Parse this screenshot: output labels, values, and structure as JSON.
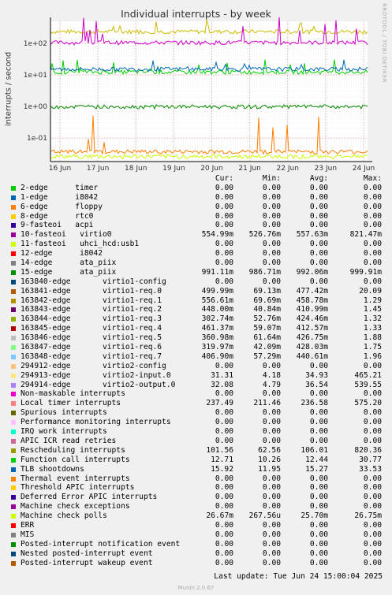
{
  "chart_data": {
    "type": "line",
    "title": "Individual interrupts - by week",
    "ylabel": "interrupts / second",
    "yscale": "log",
    "ylim": [
      0.018,
      500
    ],
    "yticks": [
      "1e+02",
      "1e+01",
      "1e+00",
      "1e-01"
    ],
    "yticks_values": [
      100,
      10,
      1,
      0.1
    ],
    "xticks": [
      "16 Jun",
      "17 Jun",
      "18 Jun",
      "19 Jun",
      "20 Jun",
      "21 Jun",
      "22 Jun",
      "23 Jun",
      "24 Jun"
    ],
    "grid": true,
    "watermark": "RRDTOOL / TOBI OETIKER",
    "series_approx": [
      {
        "name": "Local timer interrupts",
        "color": "#CCBB00",
        "typical": 236,
        "peak": 575
      },
      {
        "name": "Rescheduling interrupts",
        "color": "#CC00CC",
        "typical": 106,
        "peak": 820
      },
      {
        "name": "Function call interrupts",
        "color": "#00CC00",
        "typical": 12.4,
        "peak": 30.8
      },
      {
        "name": "TLB shootdowns",
        "color": "#0066B3",
        "typical": 15.3,
        "peak": 33.5
      },
      {
        "name": "15-edge",
        "color": "#008F00",
        "typical": 0.99,
        "peak": 1.0
      },
      {
        "name": "294914-edge",
        "color": "#FF7F00",
        "typical": 0.037,
        "peak": 0.54
      },
      {
        "name": "Machine check polls",
        "color": "#CCFF00",
        "typical": 0.026,
        "peak": 0.027
      }
    ],
    "colors": {
      "background": "#F0F0F0",
      "plot": "#FFFFFF",
      "grid": "#E0E0E0"
    }
  },
  "legend": {
    "headers": [
      "Cur:",
      "Min:",
      "Avg:",
      "Max:"
    ],
    "rows": [
      {
        "color": "#00CC00",
        "label": "2-edge      timer",
        "cur": "0.00",
        "min": "0.00",
        "avg": "0.00",
        "max": "0.00"
      },
      {
        "color": "#0066B3",
        "label": "1-edge      i8042",
        "cur": "0.00",
        "min": "0.00",
        "avg": "0.00",
        "max": "0.00"
      },
      {
        "color": "#FF8000",
        "label": "6-edge      floppy",
        "cur": "0.00",
        "min": "0.00",
        "avg": "0.00",
        "max": "0.00"
      },
      {
        "color": "#FFCC00",
        "label": "8-edge      rtc0",
        "cur": "0.00",
        "min": "0.00",
        "avg": "0.00",
        "max": "0.00"
      },
      {
        "color": "#330099",
        "label": "9-fasteoi   acpi",
        "cur": "0.00",
        "min": "0.00",
        "avg": "0.00",
        "max": "0.00"
      },
      {
        "color": "#990099",
        "label": "10-fasteoi   virtio0",
        "cur": "554.99m",
        "min": "526.76m",
        "avg": "557.63m",
        "max": "821.47m"
      },
      {
        "color": "#CCFF00",
        "label": "11-fasteoi   uhci_hcd:usb1",
        "cur": "0.00",
        "min": "0.00",
        "avg": "0.00",
        "max": "0.00"
      },
      {
        "color": "#FF0000",
        "label": "12-edge      i8042",
        "cur": "0.00",
        "min": "0.00",
        "avg": "0.00",
        "max": "0.00"
      },
      {
        "color": "#808080",
        "label": "14-edge      ata_piix",
        "cur": "0.00",
        "min": "0.00",
        "avg": "0.00",
        "max": "0.00"
      },
      {
        "color": "#008F00",
        "label": "15-edge      ata_piix",
        "cur": "991.11m",
        "min": "986.71m",
        "avg": "992.06m",
        "max": "999.91m"
      },
      {
        "color": "#00487D",
        "label": "163840-edge       virtio1-config",
        "cur": "0.00",
        "min": "0.00",
        "avg": "0.00",
        "max": "0.00"
      },
      {
        "color": "#B35A00",
        "label": "163841-edge       virtio1-req.0",
        "cur": "499.99m",
        "min": "69.13m",
        "avg": "477.42m",
        "max": "20.09"
      },
      {
        "color": "#B38F00",
        "label": "163842-edge       virtio1-req.1",
        "cur": "556.61m",
        "min": "69.69m",
        "avg": "458.78m",
        "max": "1.29"
      },
      {
        "color": "#6B006B",
        "label": "163843-edge       virtio1-req.2",
        "cur": "448.00m",
        "min": "40.84m",
        "avg": "410.99m",
        "max": "1.45"
      },
      {
        "color": "#8FB300",
        "label": "163844-edge       virtio1-req.3",
        "cur": "302.74m",
        "min": "52.76m",
        "avg": "424.46m",
        "max": "1.32"
      },
      {
        "color": "#B30000",
        "label": "163845-edge       virtio1-req.4",
        "cur": "461.37m",
        "min": "59.07m",
        "avg": "412.57m",
        "max": "1.33"
      },
      {
        "color": "#BEBEBE",
        "label": "163846-edge       virtio1-req.5",
        "cur": "360.98m",
        "min": "61.64m",
        "avg": "426.75m",
        "max": "1.88"
      },
      {
        "color": "#80FF80",
        "label": "163847-edge       virtio1-req.6",
        "cur": "319.97m",
        "min": "42.09m",
        "avg": "428.03m",
        "max": "1.75"
      },
      {
        "color": "#80C9FF",
        "label": "163848-edge       virtio1-req.7",
        "cur": "406.90m",
        "min": "57.29m",
        "avg": "440.61m",
        "max": "1.96"
      },
      {
        "color": "#FFC080",
        "label": "294912-edge       virtio2-config",
        "cur": "0.00",
        "min": "0.00",
        "avg": "0.00",
        "max": "0.00"
      },
      {
        "color": "#FFE680",
        "label": "294913-edge       virtio2-input.0",
        "cur": "31.31",
        "min": "4.18",
        "avg": "34.93",
        "max": "465.21"
      },
      {
        "color": "#AA80FF",
        "label": "294914-edge       virtio2-output.0",
        "cur": "32.08",
        "min": "4.79",
        "avg": "36.54",
        "max": "539.55"
      },
      {
        "color": "#EE00CC",
        "label": "Non-maskable interrupts",
        "cur": "0.00",
        "min": "0.00",
        "avg": "0.00",
        "max": "0.00"
      },
      {
        "color": "#FF8080",
        "label": "Local timer interrupts",
        "cur": "237.49",
        "min": "211.46",
        "avg": "236.58",
        "max": "575.20"
      },
      {
        "color": "#666600",
        "label": "Spurious interrupts",
        "cur": "0.00",
        "min": "0.00",
        "avg": "0.00",
        "max": "0.00"
      },
      {
        "color": "#FFBFFF",
        "label": "Performance monitoring interrupts",
        "cur": "0.00",
        "min": "0.00",
        "avg": "0.00",
        "max": "0.00"
      },
      {
        "color": "#00FFCC",
        "label": "IRQ work interrupts",
        "cur": "0.00",
        "min": "0.00",
        "avg": "0.00",
        "max": "0.00"
      },
      {
        "color": "#CC6699",
        "label": "APIC ICR read retries",
        "cur": "0.00",
        "min": "0.00",
        "avg": "0.00",
        "max": "0.00"
      },
      {
        "color": "#999900",
        "label": "Rescheduling interrupts",
        "cur": "101.56",
        "min": "62.56",
        "avg": "106.01",
        "max": "820.36"
      },
      {
        "color": "#00CC00",
        "label": "Function call interrupts",
        "cur": "12.71",
        "min": "10.26",
        "avg": "12.44",
        "max": "30.77"
      },
      {
        "color": "#0066B3",
        "label": "TLB shootdowns",
        "cur": "15.92",
        "min": "11.95",
        "avg": "15.27",
        "max": "33.53"
      },
      {
        "color": "#FF8000",
        "label": "Thermal event interrupts",
        "cur": "0.00",
        "min": "0.00",
        "avg": "0.00",
        "max": "0.00"
      },
      {
        "color": "#FFCC00",
        "label": "Threshold APIC interrupts",
        "cur": "0.00",
        "min": "0.00",
        "avg": "0.00",
        "max": "0.00"
      },
      {
        "color": "#330099",
        "label": "Deferred Error APIC interrupts",
        "cur": "0.00",
        "min": "0.00",
        "avg": "0.00",
        "max": "0.00"
      },
      {
        "color": "#990099",
        "label": "Machine check exceptions",
        "cur": "0.00",
        "min": "0.00",
        "avg": "0.00",
        "max": "0.00"
      },
      {
        "color": "#CCFF00",
        "label": "Machine check polls",
        "cur": "26.67m",
        "min": "267.56u",
        "avg": "25.70m",
        "max": "26.75m"
      },
      {
        "color": "#FF0000",
        "label": "ERR",
        "cur": "0.00",
        "min": "0.00",
        "avg": "0.00",
        "max": "0.00"
      },
      {
        "color": "#808080",
        "label": "MIS",
        "cur": "0.00",
        "min": "0.00",
        "avg": "0.00",
        "max": "0.00"
      },
      {
        "color": "#008F00",
        "label": "Posted-interrupt notification event",
        "cur": "0.00",
        "min": "0.00",
        "avg": "0.00",
        "max": "0.00"
      },
      {
        "color": "#00487D",
        "label": "Nested posted-interrupt event",
        "cur": "0.00",
        "min": "0.00",
        "avg": "0.00",
        "max": "0.00"
      },
      {
        "color": "#B35A00",
        "label": "Posted-interrupt wakeup event",
        "cur": "0.00",
        "min": "0.00",
        "avg": "0.00",
        "max": "0.00"
      }
    ]
  },
  "footer": {
    "last_update": "Last update: Tue Jun 24 15:00:04 2025",
    "generator": "Munin 2.0.67"
  }
}
